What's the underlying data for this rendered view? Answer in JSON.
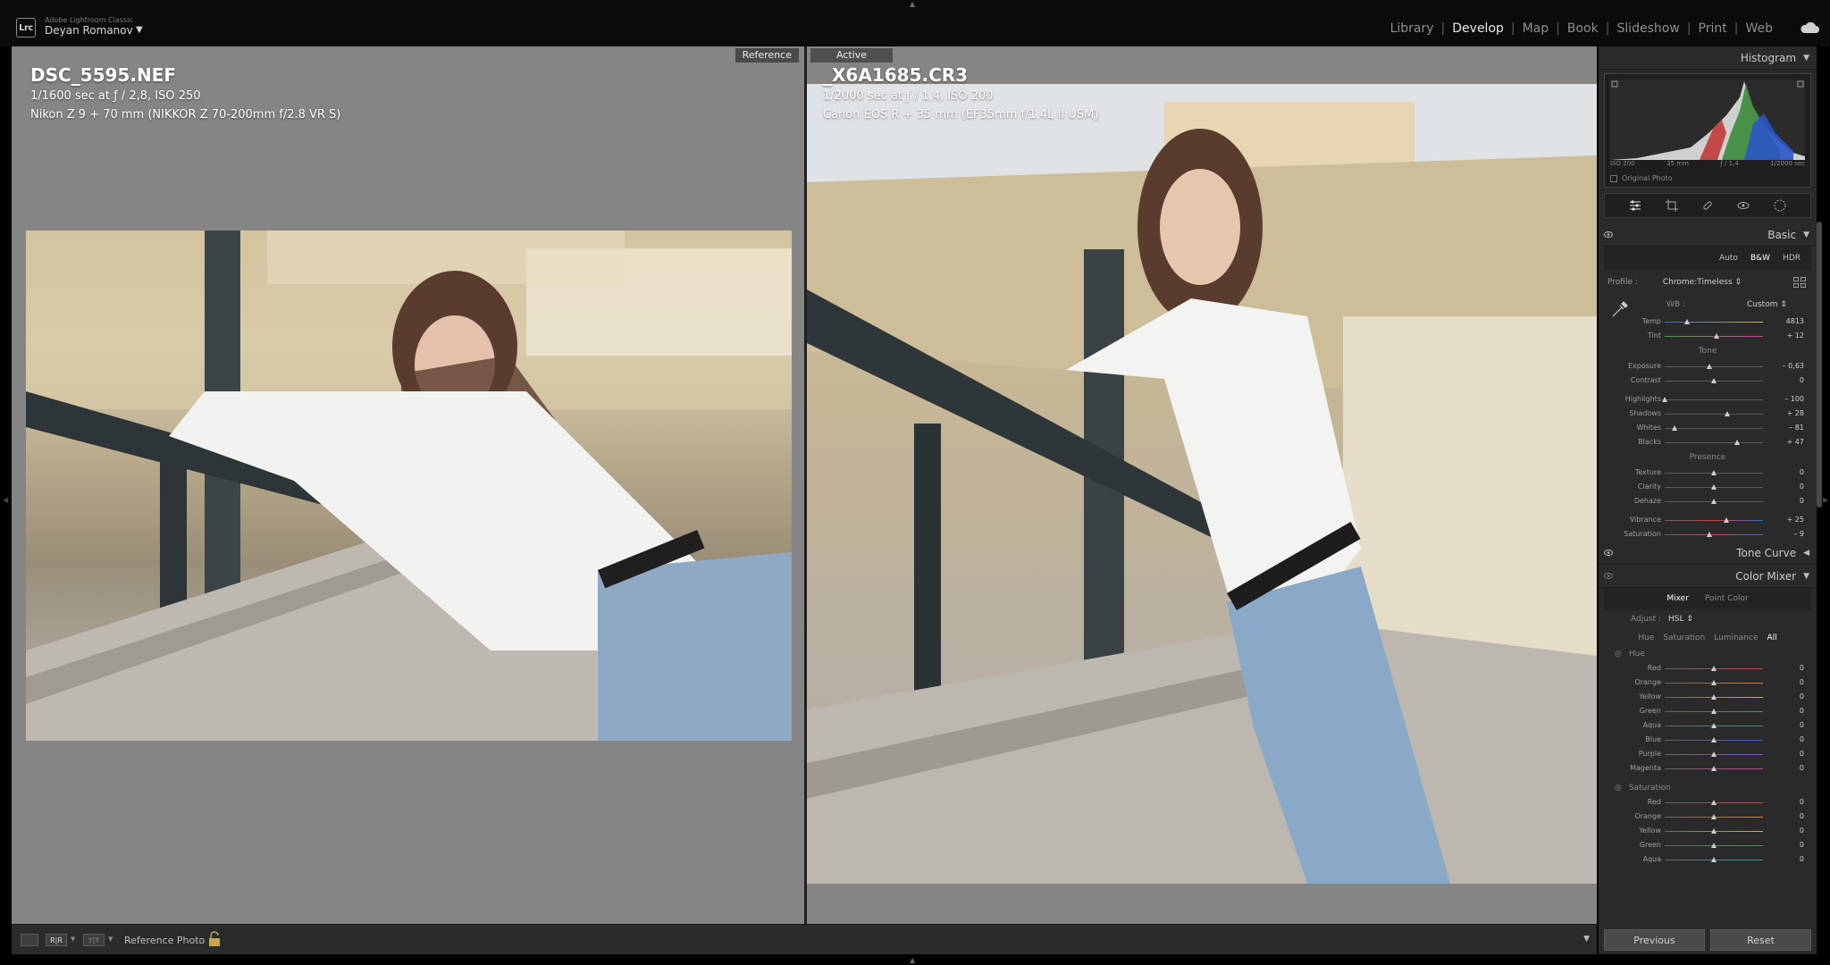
{
  "app": {
    "name": "Adobe Lightroom Classic",
    "badge": "Lrc",
    "user": "Deyan Romanov"
  },
  "modules": [
    "Library",
    "Develop",
    "Map",
    "Book",
    "Slideshow",
    "Print",
    "Web"
  ],
  "active_module": "Develop",
  "reference": {
    "tag": "Reference",
    "filename": "DSC_5595.NEF",
    "exposure": "1/1600 sec at ƒ / 2,8, ISO 250",
    "camera": "Nikon Z 9 + 70 mm (NIKKOR Z 70-200mm f/2.8 VR S)"
  },
  "active": {
    "tag": "Active",
    "filename": "_X6A1685.CR3",
    "exposure": "1/2000 sec at ƒ / 1,4, ISO 200",
    "camera": "Canon EOS R + 35 mm (EF35mm f/1.4L II USM)"
  },
  "toolbar": {
    "ref_photo_label": "Reference Photo :",
    "ref_btn": "R|R",
    "yy_btn": "Y|Y"
  },
  "histogram": {
    "title": "Histogram",
    "iso": "ISO 200",
    "focal": "35 mm",
    "aperture": "ƒ / 1,4",
    "shutter": "1/2000 sec",
    "original_photo": "Original Photo"
  },
  "basic": {
    "title": "Basic",
    "treatments": [
      "Auto",
      "B&W",
      "HDR"
    ],
    "profile_label": "Profile :",
    "profile_value": "Chrome:Timeless ⇕",
    "wb_label": "WB :",
    "wb_value": "Custom ⇕",
    "wb_sliders": [
      {
        "label": "Temp",
        "value": "4813",
        "pos": 0.23
      },
      {
        "label": "Tint",
        "value": "+ 12",
        "pos": 0.53
      }
    ],
    "tone_label": "Tone",
    "tone_sliders": [
      {
        "label": "Exposure",
        "value": "– 0,63",
        "pos": 0.45
      },
      {
        "label": "Contrast",
        "value": "0",
        "pos": 0.5
      }
    ],
    "tone_sliders2": [
      {
        "label": "Highlights",
        "value": "– 100",
        "pos": 0.0
      },
      {
        "label": "Shadows",
        "value": "+ 28",
        "pos": 0.64
      },
      {
        "label": "Whites",
        "value": "– 81",
        "pos": 0.1
      },
      {
        "label": "Blacks",
        "value": "+ 47",
        "pos": 0.74
      }
    ],
    "presence_label": "Presence",
    "presence_sliders": [
      {
        "label": "Texture",
        "value": "0",
        "pos": 0.5
      },
      {
        "label": "Clarity",
        "value": "0",
        "pos": 0.5
      },
      {
        "label": "Dehaze",
        "value": "0",
        "pos": 0.5
      }
    ],
    "presence_sliders2": [
      {
        "label": "Vibrance",
        "value": "+ 25",
        "pos": 0.63
      },
      {
        "label": "Saturation",
        "value": "– 9",
        "pos": 0.45
      }
    ]
  },
  "tone_curve": {
    "title": "Tone Curve"
  },
  "color_mixer": {
    "title": "Color Mixer",
    "tabs": [
      "Mixer",
      "Point Color"
    ],
    "adjust_label": "Adjust :",
    "adjust_value": "HSL ⇕",
    "sub_tabs": [
      "Hue",
      "Saturation",
      "Luminance",
      "All"
    ],
    "hue_label": "Hue",
    "saturation_label": "Saturation",
    "hue": [
      {
        "label": "Red",
        "value": "0"
      },
      {
        "label": "Orange",
        "value": "0"
      },
      {
        "label": "Yellow",
        "value": "0"
      },
      {
        "label": "Green",
        "value": "0"
      },
      {
        "label": "Aqua",
        "value": "0"
      },
      {
        "label": "Blue",
        "value": "0"
      },
      {
        "label": "Purple",
        "value": "0"
      },
      {
        "label": "Magenta",
        "value": "0"
      }
    ],
    "saturation": [
      {
        "label": "Red",
        "value": "0"
      },
      {
        "label": "Orange",
        "value": "0"
      },
      {
        "label": "Yellow",
        "value": "0"
      },
      {
        "label": "Green",
        "value": "0"
      },
      {
        "label": "Aqua",
        "value": "0"
      }
    ]
  },
  "panel_buttons": {
    "previous": "Previous",
    "reset": "Reset"
  },
  "colors": {
    "bg": "#2a2a2a",
    "viewer": "#858585",
    "accent": "#ffffff"
  }
}
